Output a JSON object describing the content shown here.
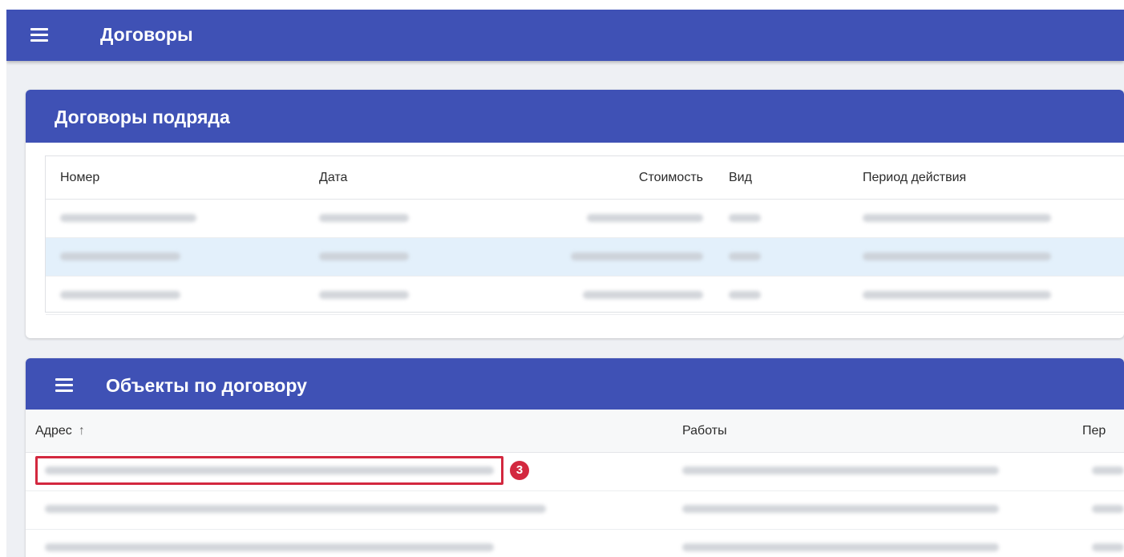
{
  "appbar": {
    "title": "Договоры"
  },
  "contracts_card": {
    "title": "Договоры подряда",
    "columns": [
      "Номер",
      "Дата",
      "Стоимость",
      "Вид",
      "Период действия"
    ]
  },
  "objects_card": {
    "title": "Объекты по договору",
    "columns": [
      "Адрес",
      "Работы",
      "Пер"
    ],
    "sort_icon": "↑",
    "badge": "3"
  },
  "colors": {
    "primary": "#3f51b5",
    "selected_row": "#e3f0fb",
    "highlight": "#d3283f",
    "background": "#eef0f4"
  },
  "icons": {
    "menu": "hamburger-menu-icon",
    "sort": "arrow-up-icon"
  }
}
